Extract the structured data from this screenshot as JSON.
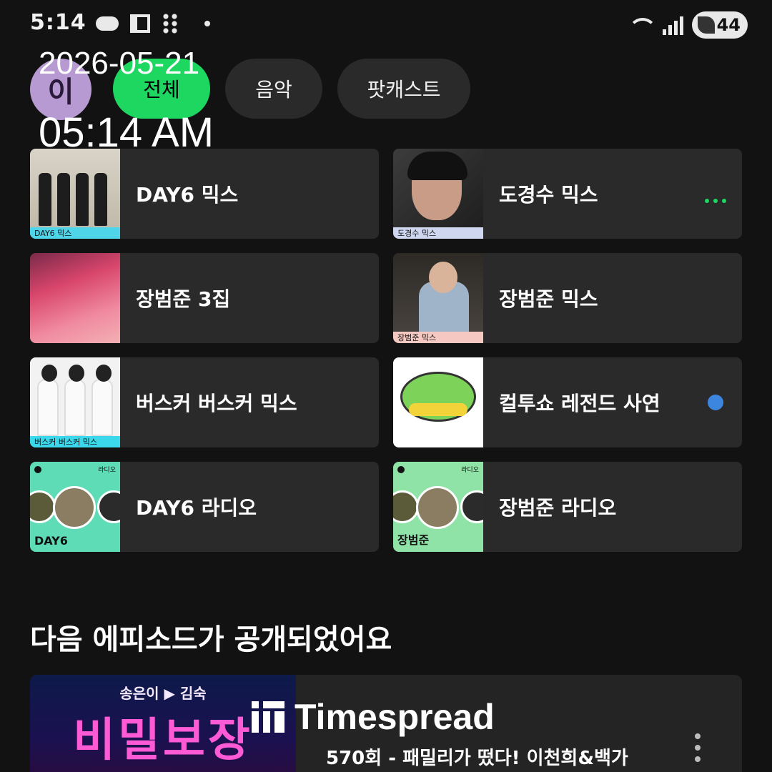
{
  "status_bar": {
    "time": "5:14",
    "battery": "44",
    "icons": [
      "cloud-icon",
      "grid-icon",
      "dots-icon",
      "wifi-icon",
      "signal-icon",
      "battery-icon"
    ]
  },
  "overlay": {
    "date": "2026-05-21",
    "time": "05:14 AM"
  },
  "header": {
    "avatar_letter": "이",
    "chips": [
      {
        "label": "전체",
        "active": true
      },
      {
        "label": "음악",
        "active": false
      },
      {
        "label": "팟캐스트",
        "active": false
      }
    ]
  },
  "tiles": [
    {
      "title": "DAY6 믹스",
      "art_label": "DAY6 믹스"
    },
    {
      "title": "도경수 믹스",
      "art_label": "도경수 믹스"
    },
    {
      "title": "장범준 3집"
    },
    {
      "title": "장범준 믹스",
      "art_label": "장범준 믹스"
    },
    {
      "title": "버스커 버스커 믹스",
      "art_label": "버스커 버스커 믹스"
    },
    {
      "title": "컬투쇼 레전드 사연"
    },
    {
      "title": "DAY6 라디오",
      "art_name": "DAY6",
      "art_badge": "라디오"
    },
    {
      "title": "장범준 라디오",
      "art_name": "장범준",
      "art_badge": "라디오"
    }
  ],
  "section": {
    "title": "다음 에피소드가 공개되었어요"
  },
  "episode": {
    "art_host": "송은이 ▶ 김숙",
    "art_title": "비밀보장",
    "title": "570회 - 패밀리가 떴다! 이천희&백가"
  },
  "watermark": {
    "text": "Timespread"
  },
  "colors": {
    "background": "#121212",
    "accent": "#1ed760",
    "tile": "#2a2a2a",
    "blue_dot": "#3d86df"
  }
}
